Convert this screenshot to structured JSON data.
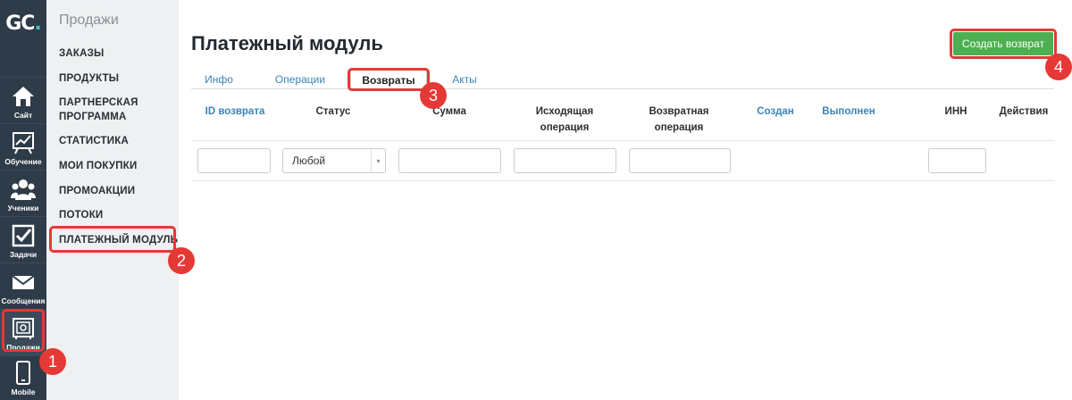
{
  "logo": {
    "text": "GC",
    "dot": "."
  },
  "rail": [
    {
      "label": "Сайт",
      "icon": "home-icon"
    },
    {
      "label": "Обучение",
      "icon": "chart-board-icon"
    },
    {
      "label": "Ученики",
      "icon": "users-icon"
    },
    {
      "label": "Задачи",
      "icon": "checkbox-icon"
    },
    {
      "label": "Сообщения",
      "icon": "envelope-icon"
    },
    {
      "label": "Продажи",
      "icon": "safe-icon"
    },
    {
      "label": "Mobile",
      "icon": "phone-icon"
    }
  ],
  "submenu": {
    "title": "Продажи",
    "items": [
      "ЗАКАЗЫ",
      "ПРОДУКТЫ",
      "ПАРТНЕРСКАЯ",
      "ПРОГРАММА",
      "СТАТИСТИКА",
      "МОИ ПОКУПКИ",
      "ПРОМОАКЦИИ",
      "ПОТОКИ",
      "ПЛАТЕЖНЫЙ МОДУЛЬ"
    ]
  },
  "page": {
    "title": "Платежный модуль",
    "create_button": "Создать возврат"
  },
  "tabs": [
    "Инфо",
    "Операции",
    "Возвраты",
    "Акты"
  ],
  "table": {
    "headers": {
      "id": "ID возврата",
      "status": "Статус",
      "sum": "Сумма",
      "source_1": "Исходящая",
      "source_2": "операция",
      "return_1": "Возвратная",
      "return_2": "операция",
      "created": "Создан",
      "done": "Выполнен",
      "inn": "ИНН",
      "actions": "Действия"
    },
    "status_filter_value": "Любой"
  },
  "annotations": [
    "1",
    "2",
    "3",
    "4"
  ],
  "colors": {
    "rail_bg": "#2e3b48",
    "submenu_bg": "#eef0f1",
    "link": "#3a83b7",
    "primary_button": "#4caf50",
    "highlight": "#e53935"
  }
}
